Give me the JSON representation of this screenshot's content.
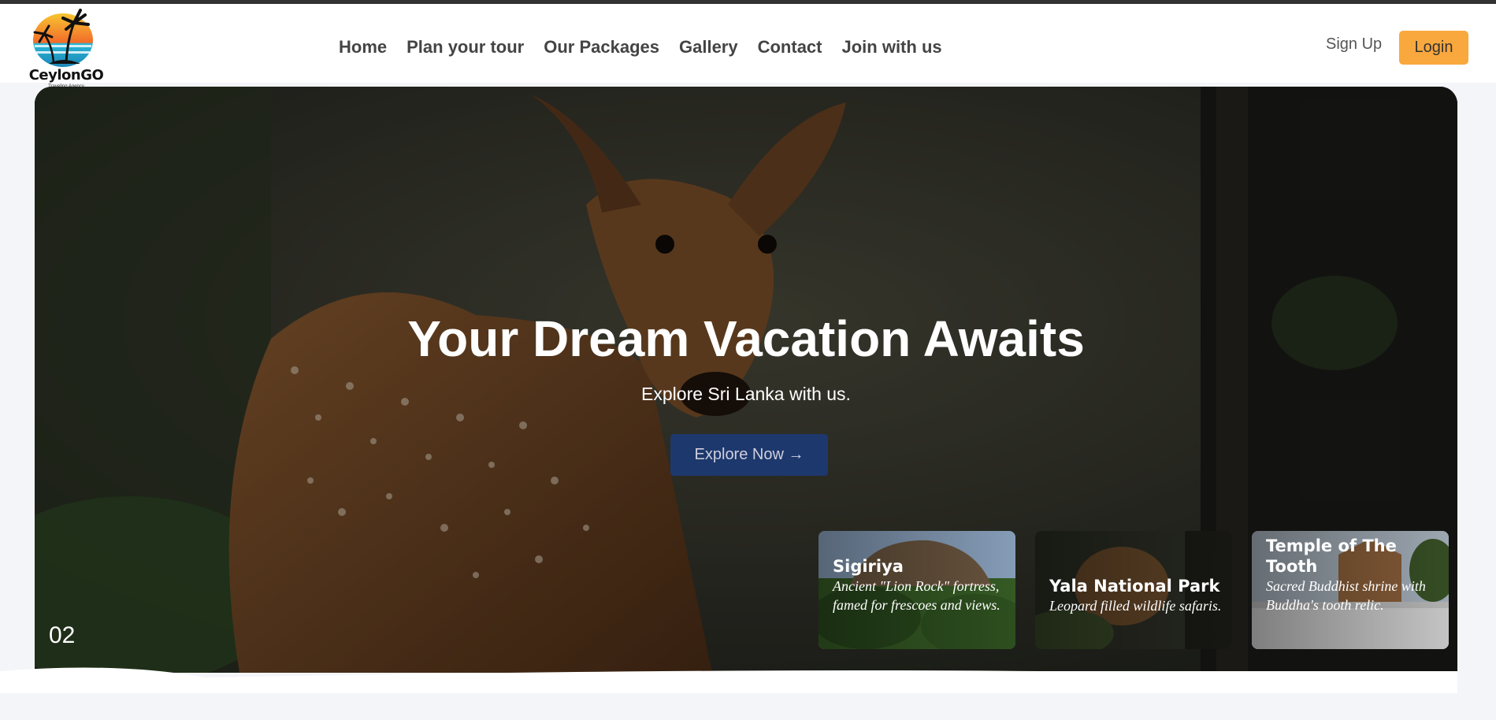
{
  "brand": {
    "name": "CeylonGO",
    "tagline": "Traveling Agency"
  },
  "nav": [
    {
      "label": "Home"
    },
    {
      "label": "Plan your tour"
    },
    {
      "label": "Our Packages"
    },
    {
      "label": "Gallery"
    },
    {
      "label": "Contact"
    },
    {
      "label": "Join with us"
    }
  ],
  "auth": {
    "signup": "Sign Up",
    "login": "Login"
  },
  "hero": {
    "title": "Your Dream Vacation Awaits",
    "subtitle": "Explore Sri Lanka with us.",
    "cta": "Explore Now →",
    "slide_number": "02"
  },
  "cards": [
    {
      "title": "Sigiriya",
      "description": "Ancient \"Lion Rock\" fortress, famed for frescoes and views."
    },
    {
      "title": "Yala National Park",
      "description": "Leopard filled wildlife safaris."
    },
    {
      "title": "Temple of The Tooth",
      "description": "Sacred Buddhist shrine with Buddha's tooth relic."
    }
  ],
  "colors": {
    "accent": "#f9a83d",
    "cta": "#1c3a73",
    "nav_text": "#444444"
  }
}
